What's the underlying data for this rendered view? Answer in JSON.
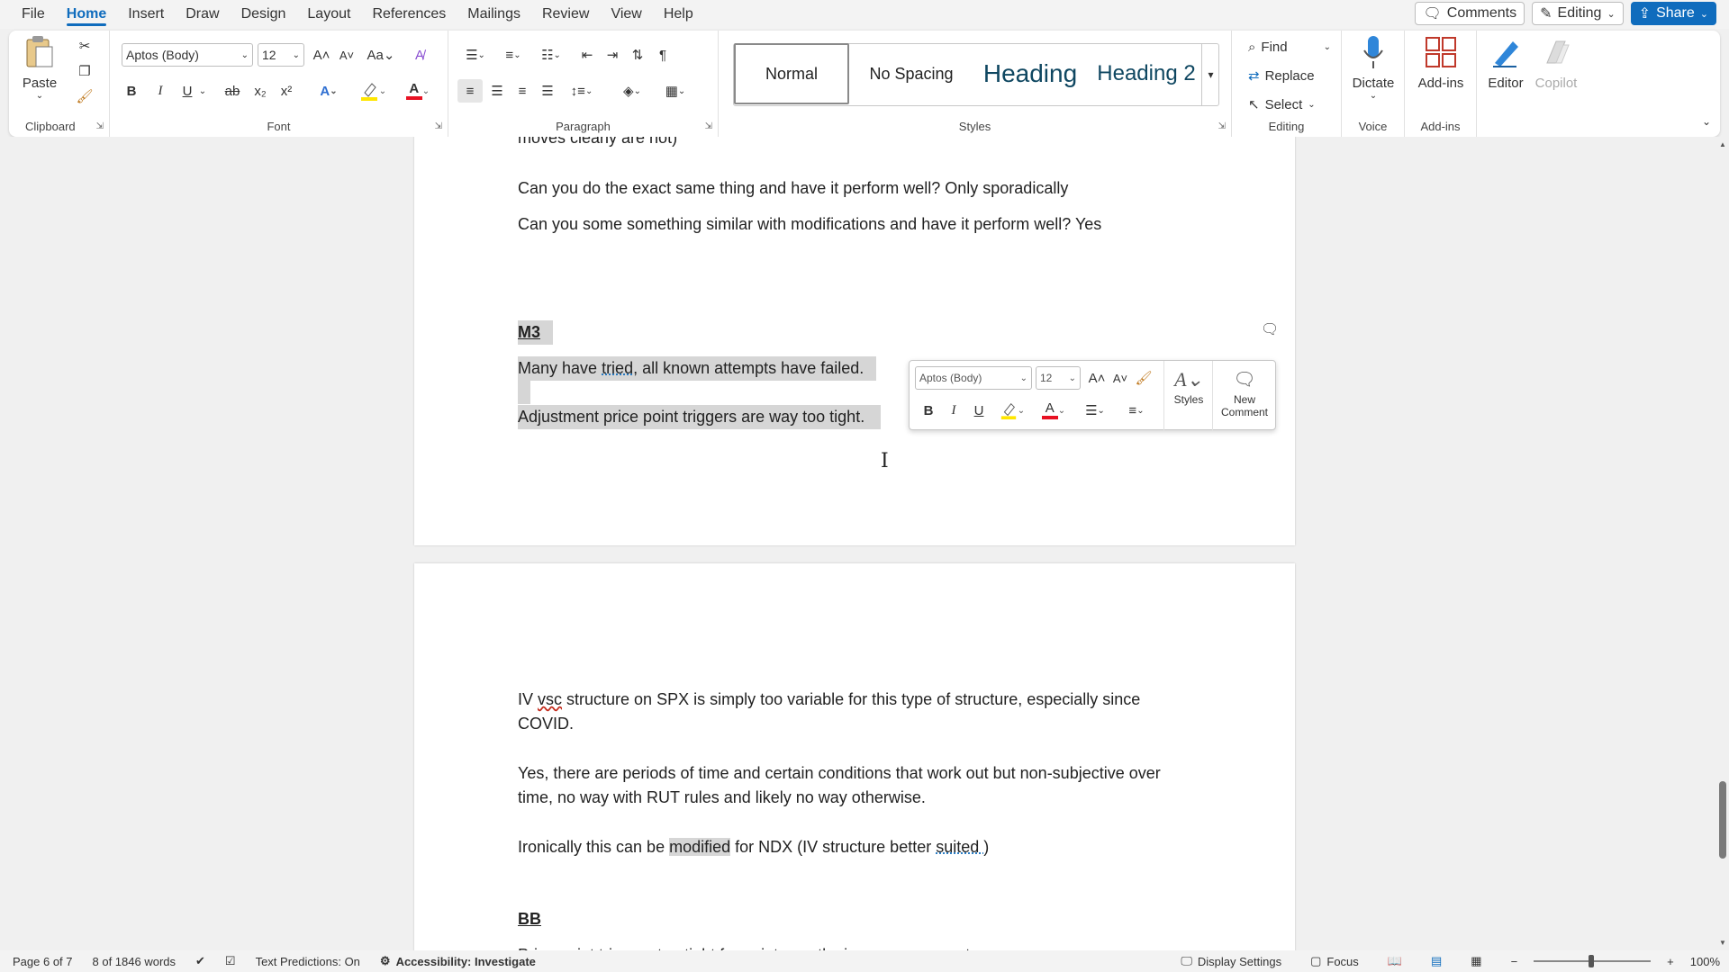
{
  "menu": {
    "tabs": [
      "File",
      "Home",
      "Insert",
      "Draw",
      "Design",
      "Layout",
      "References",
      "Mailings",
      "Review",
      "View",
      "Help"
    ],
    "active": "Home",
    "comments_label": "Comments",
    "editing_label": "Editing",
    "share_label": "Share"
  },
  "ribbon": {
    "clipboard": {
      "label": "Clipboard",
      "paste": "Paste"
    },
    "font": {
      "label": "Font",
      "font_name": "Aptos (Body)",
      "font_size": "12"
    },
    "paragraph": {
      "label": "Paragraph"
    },
    "styles": {
      "label": "Styles",
      "items": [
        "Normal",
        "No Spacing",
        "Heading",
        "Heading 2"
      ]
    },
    "editing": {
      "label": "Editing",
      "find": "Find",
      "replace": "Replace",
      "select": "Select"
    },
    "voice": {
      "label": "Voice",
      "dictate": "Dictate"
    },
    "addins": {
      "label": "Add-ins",
      "addins_btn": "Add-ins"
    },
    "editor": "Editor",
    "copilot": "Copilot"
  },
  "document": {
    "cut_line": "moves clearly are not)",
    "p1": "Can you do the exact same thing and have it perform well? Only sporadically",
    "p2": "Can you some something similar with modifications and have it perform well? Yes",
    "m3_heading": "M3",
    "m3_line1_a": "Many have ",
    "m3_line1_b": "tried,",
    "m3_line1_c": " all known attempts have failed.",
    "m3_line2": "Adjustment price point triggers are way too tight.",
    "p3_a": "IV ",
    "p3_b": "vsc",
    "p3_c": " structure on SPX is simply too variable for this type of structure, especially since",
    "p3_d": "COVID.",
    "p4_a": "Yes, there are periods of time and certain conditions that work out but non-subjective over",
    "p4_b": "time, no way with RUT rules and likely no way otherwise.",
    "p5_a": "Ironically this can be ",
    "p5_b": "modified",
    "p5_c": " for NDX (IV structure better ",
    "p5_d": "suited )",
    "bb_heading": "BB",
    "bb_cut": "Price point triggers too tight for point growth via new moves not"
  },
  "mini_toolbar": {
    "font_name": "Aptos (Body)",
    "font_size": "12",
    "styles": "Styles",
    "new_comment_1": "New",
    "new_comment_2": "Comment"
  },
  "status": {
    "page": "Page 6 of 7",
    "words": "8 of 1846 words",
    "text_predictions": "Text Predictions: On",
    "accessibility": "Accessibility: Investigate",
    "display_settings": "Display Settings",
    "focus": "Focus",
    "zoom": "100%"
  },
  "colors": {
    "accent": "#0f6cbd",
    "selection": "#d6d6d6",
    "highlight_yellow": "#ffe600",
    "font_red": "#e81123"
  }
}
